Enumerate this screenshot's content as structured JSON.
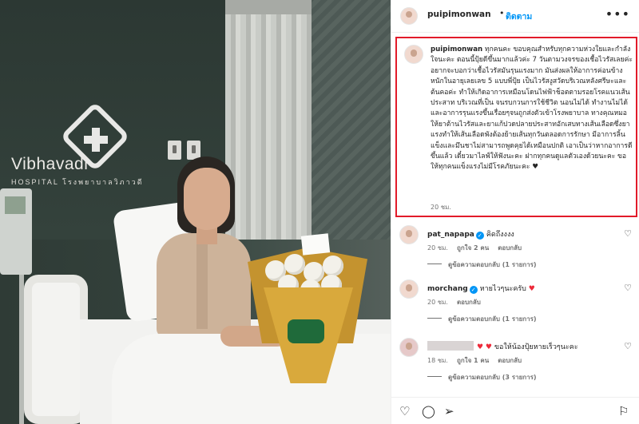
{
  "photo": {
    "logo_name": "Vibhavadi",
    "logo_sub": "HOSPITAL โรงพยาบาลวิภาวดี",
    "card_text": ""
  },
  "post": {
    "username": "puipimonwan",
    "separator": "•",
    "follow_label": "ติดตาม",
    "more_icon": "more-horizontal-icon"
  },
  "caption": {
    "username": "puipimonwan",
    "text": "ทุกคนคะ ขอบคุณสำหรับทุกความห่วงใยและกำลังใจนะคะ ตอนนี้ปุ้ยดีขึ้นมากแล้วค่ะ 7 วันตามวงจรของเชื้อไวรัสเลยค่ะ อยากจะบอกว่าเชื้อไวรัสมันรุนแรงมาก มันส่งผลให้อาการค่อนข้างหนักในอายุเลยเลข 5 แบบพี่ปุ้ย เป็นไวรัสงูสวัดบริเวณหลังศรีษะและต้นคอค่ะ ทำให้เกิดอาการเหมือนโดนไฟฟ้าช็อตตามรอยโรคแนวเส้นประสาท บริเวณที่เป็น จนรบกวนการใช้ชีวิต นอนไม่ได้ ทำงานไม่ได้ และอาการรุนแรงขึ้นเรื่อยๆจนถูกส่งตัวเข้าโรงพยาบาล ทางคุณหมอให้ยาต้านไวรัสและยาแก้ปวดปลายประสาทอักเสบทางเส้นเลือดซึ่งยาแรงทำให้เส้นเลือดพังต้องย้ายเส้นทุกวันตลอดการรักษา มีอาการลิ้นแข็งและมึนชาไม่สามารถพูดคุยได้เหมือนปกติ เอาเป็นว่าหากอาการดีขึ้นแล้ว เดี๋ยวมาไลฟ์ให้ฟังนะคะ ฝากทุกคนดูแลตัวเองด้วยนะคะ ขอให้ทุกคนแข็งแรงไม่มีโรคภัยนะคะ ♥",
    "time": "20 ชม."
  },
  "comments": [
    {
      "username": "pat_napapa",
      "verified": true,
      "text": "คิดถึงงงง",
      "time": "20 ชม.",
      "likes": "ถูกใจ 2 คน",
      "reply_label": "ตอบกลับ",
      "view_replies": "ดูข้อความตอบกลับ (1 รายการ)"
    },
    {
      "username": "morchang",
      "verified": true,
      "text": "หายไวๆนะครับ",
      "time": "20 ชม.",
      "likes": "",
      "reply_label": "ตอบกลับ",
      "view_replies": "ดูข้อความตอบกลับ (1 รายการ)"
    },
    {
      "username": "",
      "verified": false,
      "text": "ขอให้น้องปุ้ยหายเร็วๆนะคะ",
      "time": "18 ชม.",
      "likes": "ถูกใจ 1 คน",
      "reply_label": "ตอบกลับ",
      "view_replies": "ดูข้อความตอบกลับ (3 รายการ)"
    }
  ],
  "actions": {
    "like_icon": "heart-icon",
    "comment_icon": "comment-icon",
    "share_icon": "share-icon",
    "save_icon": "bookmark-icon"
  },
  "colors": {
    "follow_blue": "#0095f6",
    "highlight_red": "#e21b2a",
    "verified_blue": "#0095f6"
  }
}
